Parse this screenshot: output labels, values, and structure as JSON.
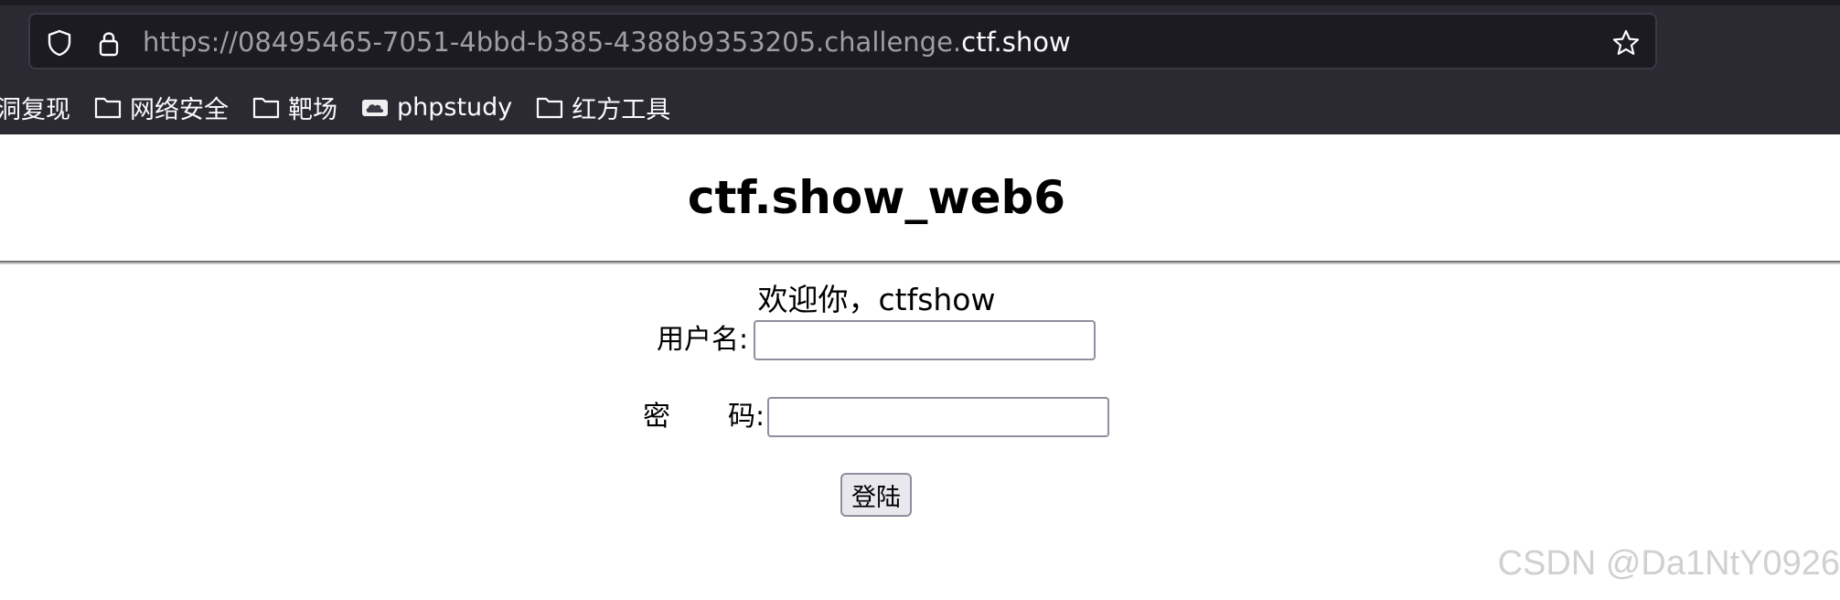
{
  "browser": {
    "url_dim": "https://08495465-7051-4bbd-b385-4388b9353205.challenge.",
    "url_bright": "ctf.show",
    "bookmarks": [
      {
        "label": "洞复现",
        "icon": "none"
      },
      {
        "label": "网络安全",
        "icon": "folder-icon"
      },
      {
        "label": "靶场",
        "icon": "folder-icon"
      },
      {
        "label": "phpstudy",
        "icon": "cloud-favicon-icon"
      },
      {
        "label": "红方工具",
        "icon": "folder-icon"
      }
    ]
  },
  "page": {
    "title": "ctf.show_web6",
    "welcome": "欢迎你，ctfshow",
    "username_label": "用户名:",
    "password_label_left": "密",
    "password_label_right": "码:",
    "login_button": "登陆",
    "username_value": "",
    "password_value": ""
  },
  "watermark": "CSDN @Da1NtY0926",
  "colors": {
    "chrome_bg": "#2b2a33",
    "urlbar_bg": "#1c1b22",
    "url_dim": "#9e9ea6",
    "url_bright": "#fbfbfe",
    "page_bg": "#ffffff"
  }
}
